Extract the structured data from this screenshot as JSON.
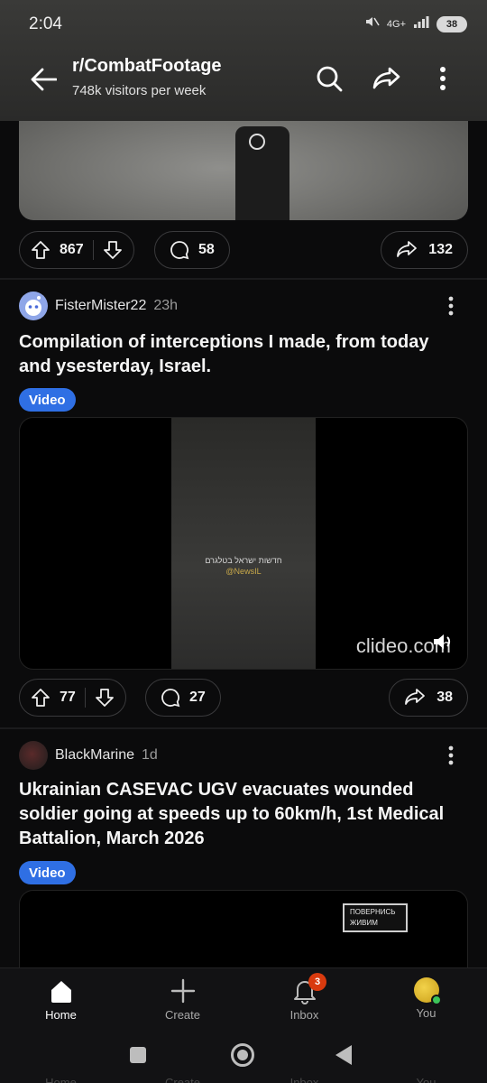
{
  "status_bar": {
    "time": "2:04",
    "network": "4G+",
    "battery": "38"
  },
  "header": {
    "title": "r/CombatFootage",
    "subtitle": "748k visitors per week",
    "back_icon": "arrow-left-icon",
    "search_icon": "search-icon",
    "share_icon": "share-icon",
    "more_icon": "more-vertical-icon"
  },
  "posts": [
    {
      "upvotes": "867",
      "comments": "58",
      "shares": "132"
    },
    {
      "author": "FisterMister22",
      "age": "23h",
      "title": "Compilation of interceptions I made, from today and ysesterday, Israel.",
      "flair": "Video",
      "video": {
        "caption_line1": "חדשות ישראל בטלגרם",
        "caption_line2": "@NewsIL",
        "watermark": "clideo.com"
      },
      "upvotes": "77",
      "comments": "27",
      "shares": "38"
    },
    {
      "author": "BlackMarine",
      "age": "1d",
      "title": "Ukrainian CASEVAC UGV evacuates wounded soldier going at speeds up to 60km/h, 1st Medical Battalion, March 2026",
      "flair": "Video",
      "video": {
        "poster_text": "ПОВЕРНИСЬ ЖИВИМ"
      }
    }
  ],
  "bottom_nav": [
    {
      "label": "Home",
      "icon": "home-icon",
      "active": true
    },
    {
      "label": "Create",
      "icon": "plus-icon",
      "active": false
    },
    {
      "label": "Inbox",
      "icon": "bell-icon",
      "active": false,
      "badge": "3"
    },
    {
      "label": "You",
      "icon": "avatar",
      "active": false
    }
  ],
  "colors": {
    "accent_flair": "#2f6fe4",
    "badge": "#d93a0e",
    "background": "#0b0b0c"
  }
}
